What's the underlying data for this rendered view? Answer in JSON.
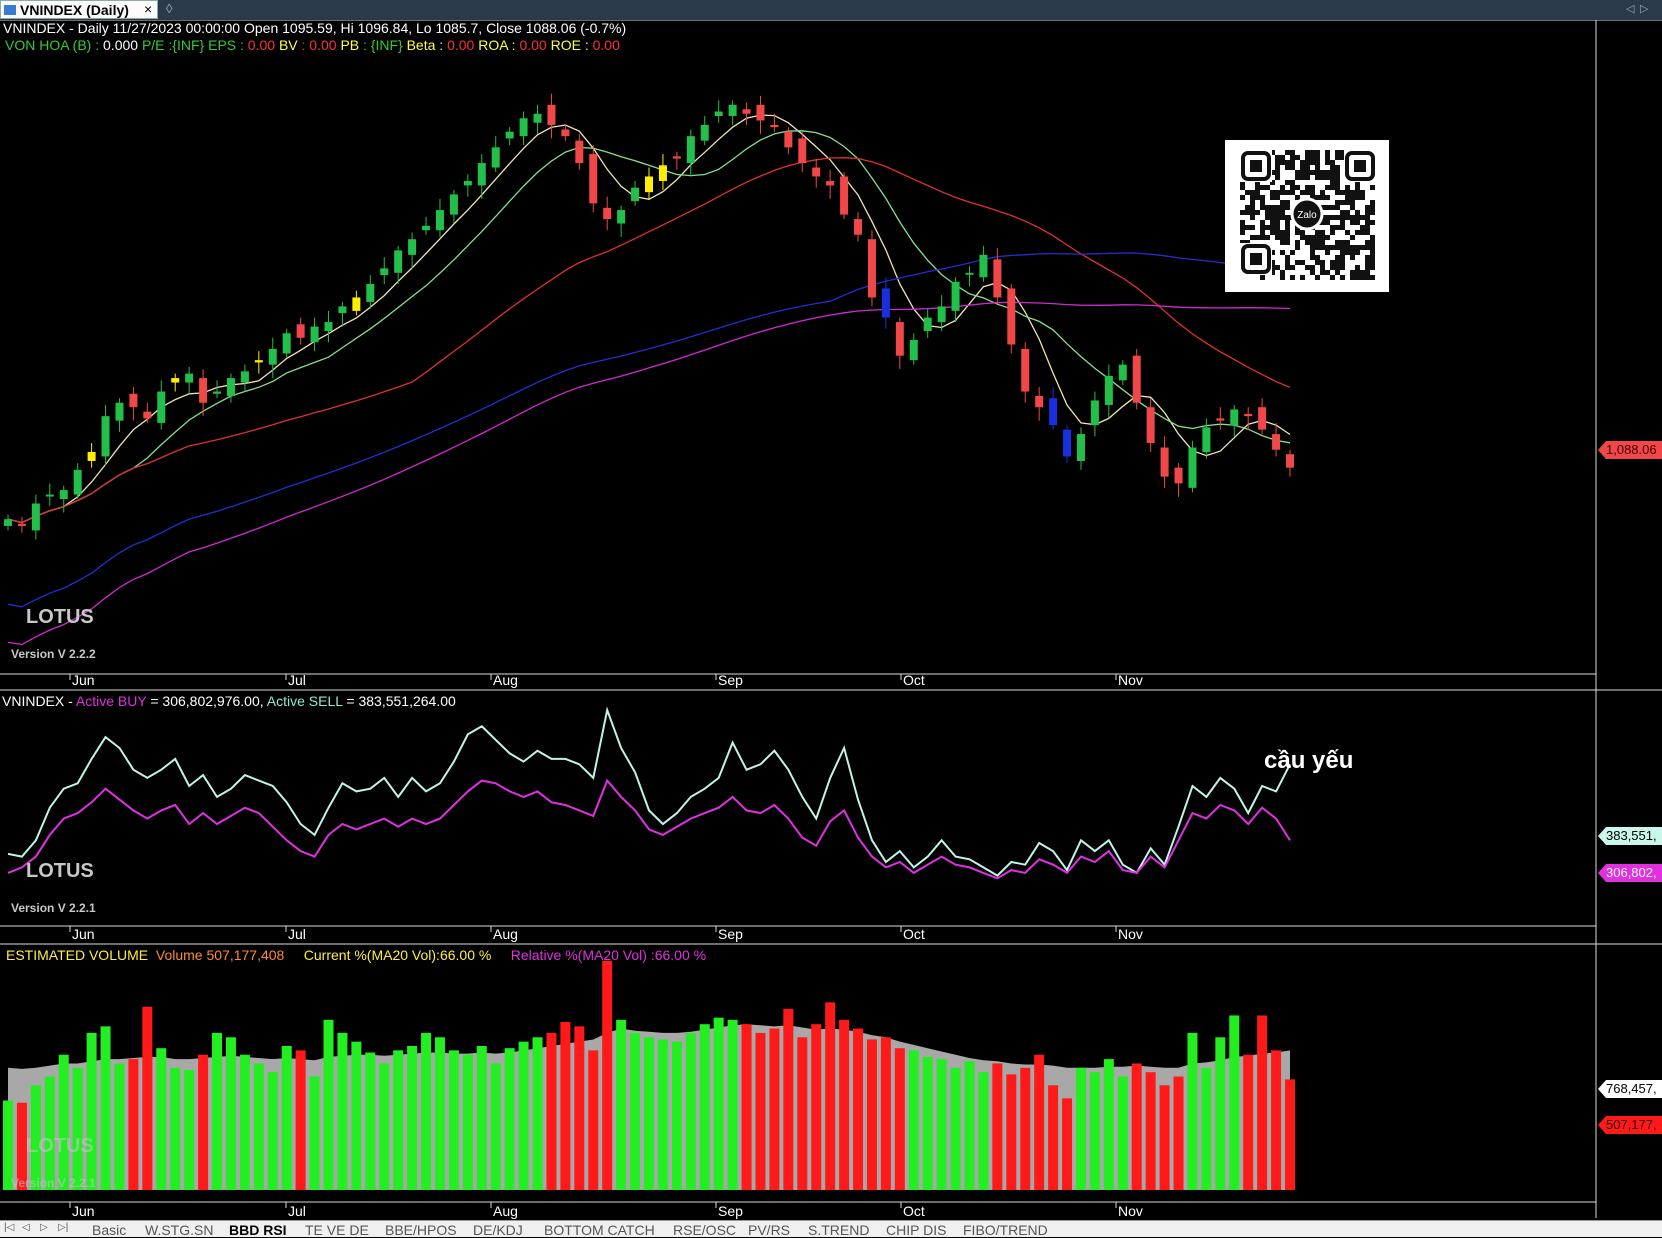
{
  "window": {
    "tab_title": "VNINDEX (Daily)",
    "close_glyph": "×",
    "add_glyph": "◊",
    "nav_prev": "◁",
    "nav_next": "▷"
  },
  "header": {
    "line1": "VNINDEX - Daily 11/27/2023 00:00:00 Open 1095.59, Hi 1096.84, Lo 1085.7, Close 1088.06 (-0.7%)",
    "metrics": [
      {
        "label": "VON HOA (B) :",
        "value": "0.000",
        "label_color": "#33cc33",
        "value_color": "#ffffff"
      },
      {
        "label": "P/E",
        "value": ":{INF}",
        "label_color": "#33cc33",
        "value_color": "#33cc33"
      },
      {
        "label": "EPS :",
        "value": "0.00",
        "label_color": "#33cc33",
        "value_color": "#ff3030"
      },
      {
        "label": "BV",
        "value": ": 0.00",
        "label_color": "#ffff40",
        "value_color": "#ff3030"
      },
      {
        "label": "PB",
        "value": ": {INF}",
        "label_color": "#ffff40",
        "value_color": "#33cc33"
      },
      {
        "label": "Beta :",
        "value": "0.00",
        "label_color": "#ffff40",
        "value_color": "#ff3030"
      },
      {
        "label": "ROA :",
        "value": "0.00",
        "label_color": "#ffff40",
        "value_color": "#ff3030"
      },
      {
        "label": "ROE :",
        "value": "0.00",
        "label_color": "#ffff40",
        "value_color": "#ff3030"
      }
    ]
  },
  "price_panel": {
    "brand": "LOTUS",
    "version": "Version V 2.2.2",
    "last_price_label": "1,088.06",
    "months": [
      "Jun",
      "Jul",
      "Aug",
      "Sep",
      "Oct",
      "Nov"
    ]
  },
  "flow_panel": {
    "prefix": "VNINDEX -",
    "buy_label": "Active BUY",
    "buy_value": "= 306,802,976.00,",
    "sell_label": "Active SELL",
    "sell_value": "= 383,551,264.00",
    "annotation": "cầu yếu",
    "brand": "LOTUS",
    "version": "Version V 2.2.1",
    "sell_axis_label": "383,551,",
    "buy_axis_label": "306,802,",
    "months": [
      "Jun",
      "Jul",
      "Aug",
      "Sep",
      "Oct",
      "Nov"
    ]
  },
  "volume_panel": {
    "title": "ESTIMATED VOLUME",
    "volume": "Volume 507,177,408",
    "current": "Current %(MA20 Vol):66.00 %",
    "relative": "Relative %(MA20 Vol) :66.00 %",
    "brand": "LOTUS",
    "version": "Version V 2.2.1",
    "ma_axis_label": "768,457,",
    "vol_axis_label": "507,177,",
    "months": [
      "Jun",
      "Jul",
      "Aug",
      "Sep",
      "Oct",
      "Nov"
    ]
  },
  "bottom_tabs": [
    "Basic",
    "W.STG.SN",
    "BBD RSI",
    "TE VE DE",
    "BBE/HPOS",
    "DE/KDJ",
    "BOTTOM CATCH",
    "RSE/OSC",
    "PV/RS",
    "S.TREND",
    "CHIP DIS",
    "FIBO/TREND"
  ],
  "active_tab": "BBD RSI",
  "colors": {
    "up": "#22c04a",
    "down": "#f04848",
    "yellow": "#ffee00",
    "blue": "#1a2fe0",
    "ma_fast": "#f2e6b0",
    "ma_mid": "#86e08a",
    "ma_red": "#e03030",
    "ma_blue": "#2030d0",
    "ma_magenta": "#d02bd0",
    "sell_line": "#bff5e8",
    "buy_line": "#e030e0",
    "vol_up": "#22ee22",
    "vol_down": "#ff1a1a",
    "vol_ma": "#a8a8a8"
  },
  "chart_data": [
    {
      "type": "candlestick",
      "series_values": [
        1065,
        1062,
        1072,
        1076,
        1078,
        1087,
        1095,
        1111,
        1117,
        1115,
        1110,
        1122,
        1128,
        1130,
        1117,
        1122,
        1128,
        1131,
        1136,
        1141,
        1148,
        1146,
        1151,
        1153,
        1160,
        1164,
        1170,
        1177,
        1185,
        1190,
        1196,
        1203,
        1210,
        1216,
        1224,
        1231,
        1238,
        1244,
        1246,
        1241,
        1236,
        1224,
        1206,
        1199,
        1203,
        1213,
        1218,
        1223,
        1226,
        1236,
        1241,
        1247,
        1250,
        1246,
        1243,
        1240,
        1231,
        1224,
        1218,
        1214,
        1201,
        1192,
        1164,
        1155,
        1138,
        1145,
        1155,
        1160,
        1171,
        1175,
        1183,
        1164,
        1143,
        1122,
        1115,
        1107,
        1093,
        1103,
        1118,
        1129,
        1134,
        1117,
        1099,
        1084,
        1081,
        1097,
        1106,
        1109,
        1114,
        1111,
        1105,
        1096,
        1088
      ],
      "ohlc_last": {
        "open": 1095.59,
        "high": 1096.84,
        "low": 1085.7,
        "close": 1088.06
      },
      "ylim": [
        1020,
        1270
      ]
    },
    {
      "type": "line",
      "series": [
        {
          "name": "Active SELL",
          "values": [
            47,
            46,
            52,
            64,
            71,
            73,
            82,
            90,
            86,
            78,
            75,
            78,
            82,
            72,
            76,
            68,
            71,
            76,
            74,
            72,
            66,
            58,
            54,
            64,
            73,
            70,
            71,
            75,
            68,
            75,
            70,
            73,
            81,
            91,
            94,
            89,
            84,
            81,
            85,
            82,
            82,
            80,
            75,
            100,
            86,
            77,
            63,
            58,
            62,
            68,
            71,
            75,
            88,
            78,
            80,
            85,
            78,
            68,
            60,
            75,
            86,
            67,
            52,
            44,
            48,
            42,
            46,
            52,
            46,
            45,
            42,
            39,
            44,
            43,
            51,
            48,
            41,
            52,
            48,
            52,
            43,
            40,
            49,
            43,
            57,
            72,
            68,
            75,
            71,
            62,
            72,
            70,
            80
          ]
        },
        {
          "name": "Active BUY",
          "values": [
            40,
            42,
            46,
            54,
            60,
            62,
            66,
            71,
            67,
            63,
            60,
            63,
            65,
            58,
            62,
            58,
            61,
            64,
            62,
            57,
            52,
            48,
            46,
            54,
            58,
            56,
            58,
            60,
            57,
            60,
            58,
            60,
            65,
            70,
            74,
            73,
            70,
            68,
            70,
            66,
            65,
            63,
            61,
            74,
            68,
            63,
            56,
            54,
            57,
            60,
            62,
            64,
            68,
            63,
            62,
            65,
            60,
            53,
            50,
            59,
            63,
            53,
            46,
            42,
            44,
            40,
            43,
            46,
            43,
            42,
            40,
            38,
            41,
            40,
            45,
            43,
            40,
            46,
            44,
            48,
            41,
            40,
            46,
            42,
            52,
            62,
            60,
            65,
            63,
            58,
            64,
            60,
            52
          ]
        }
      ]
    },
    {
      "type": "bar",
      "name": "ESTIMATED VOLUME",
      "values": [
        410,
        400,
        480,
        520,
        620,
        560,
        720,
        750,
        580,
        600,
        840,
        650,
        560,
        550,
        620,
        720,
        700,
        620,
        580,
        540,
        660,
        640,
        520,
        780,
        720,
        680,
        630,
        580,
        640,
        660,
        720,
        700,
        640,
        620,
        660,
        580,
        650,
        680,
        700,
        720,
        770,
        750,
        640,
        1050,
        780,
        720,
        700,
        690,
        680,
        720,
        760,
        790,
        780,
        760,
        720,
        740,
        830,
        700,
        760,
        860,
        780,
        740,
        690,
        700,
        650,
        640,
        610,
        600,
        560,
        590,
        540,
        580,
        530,
        560,
        620,
        480,
        420,
        560,
        540,
        600,
        520,
        580,
        540,
        480,
        520,
        720,
        560,
        700,
        800,
        620,
        800,
        640,
        507
      ],
      "ma": [
        560,
        555,
        560,
        570,
        580,
        580,
        590,
        600,
        600,
        605,
        610,
        610,
        600,
        600,
        605,
        610,
        615,
        610,
        605,
        600,
        605,
        600,
        595,
        610,
        615,
        620,
        620,
        615,
        620,
        625,
        630,
        630,
        625,
        625,
        630,
        625,
        630,
        640,
        650,
        660,
        670,
        680,
        690,
        720,
        740,
        730,
        725,
        720,
        720,
        725,
        735,
        745,
        755,
        760,
        755,
        750,
        755,
        745,
        735,
        740,
        735,
        725,
        710,
        700,
        680,
        665,
        650,
        635,
        620,
        605,
        595,
        590,
        580,
        575,
        575,
        570,
        560,
        560,
        560,
        565,
        565,
        570,
        565,
        560,
        560,
        580,
        585,
        595,
        610,
        615,
        625,
        630,
        640
      ],
      "ylim": [
        0,
        1100
      ]
    }
  ]
}
